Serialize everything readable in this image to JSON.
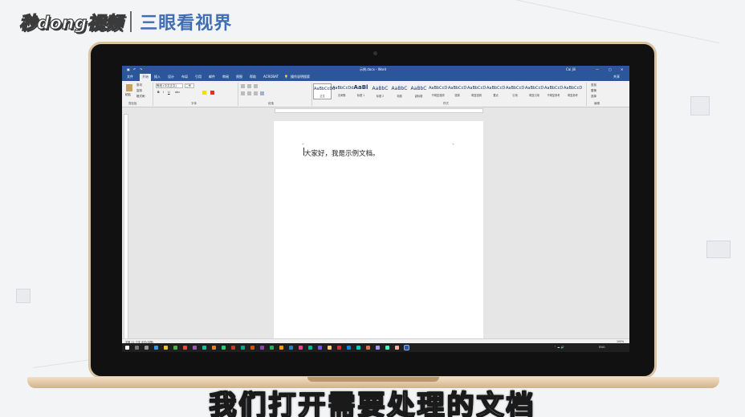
{
  "logo": {
    "main": "秒dong视频",
    "sub": "三眼看视界"
  },
  "word": {
    "title": "示例.docx - Word",
    "account": "Cai Jili",
    "tabs": [
      "文件",
      "开始",
      "插入",
      "设计",
      "布局",
      "引用",
      "邮件",
      "审阅",
      "视图",
      "帮助",
      "ACROBAT",
      "操作说明搜索"
    ],
    "active_tab_index": 1,
    "share_label": "共享",
    "group_labels": {
      "clipboard": "剪贴板",
      "font": "字体",
      "paragraph": "段落",
      "styles": "样式",
      "editing": "编辑"
    },
    "font_name": "等线 (中文正文)",
    "font_size": "二号",
    "clipboard": {
      "paste": "粘贴",
      "cut": "剪切",
      "copy": "复制",
      "format_painter": "格式刷"
    },
    "styles": [
      {
        "sample": "AaBbCcDd",
        "name": "正文"
      },
      {
        "sample": "AaBbCcDd",
        "name": "无间隔"
      },
      {
        "sample": "AaBl",
        "name": "标题 1"
      },
      {
        "sample": "AaBbC",
        "name": "标题 2"
      },
      {
        "sample": "AaBbC",
        "name": "标题"
      },
      {
        "sample": "AaBbC",
        "name": "副标题"
      },
      {
        "sample": "AaBbCcD",
        "name": "不明显强调"
      },
      {
        "sample": "AaBbCcD",
        "name": "强调"
      },
      {
        "sample": "AaBbCcD",
        "name": "明显强调"
      },
      {
        "sample": "AaBbCcD",
        "name": "要点"
      },
      {
        "sample": "AaBbCcD",
        "name": "引用"
      },
      {
        "sample": "AaBbCcD",
        "name": "明显引用"
      },
      {
        "sample": "AaBbCcD",
        "name": "不明显参考"
      },
      {
        "sample": "AaBbCcD",
        "name": "明显参考"
      }
    ],
    "editing": {
      "find": "查找",
      "replace": "替换",
      "select": "选择"
    },
    "document_text": "大家好，我是示例文档。",
    "status_left": "字数 11 个字 中文(中国)",
    "zoom": "100%"
  },
  "taskbar": {
    "time": "ENG"
  },
  "subtitle": "我们打开需要处理的文档",
  "colors": {
    "word_blue": "#2b579a",
    "logo_blue": "#3f6eb5",
    "laptop_gold": "#d9c2a1"
  }
}
